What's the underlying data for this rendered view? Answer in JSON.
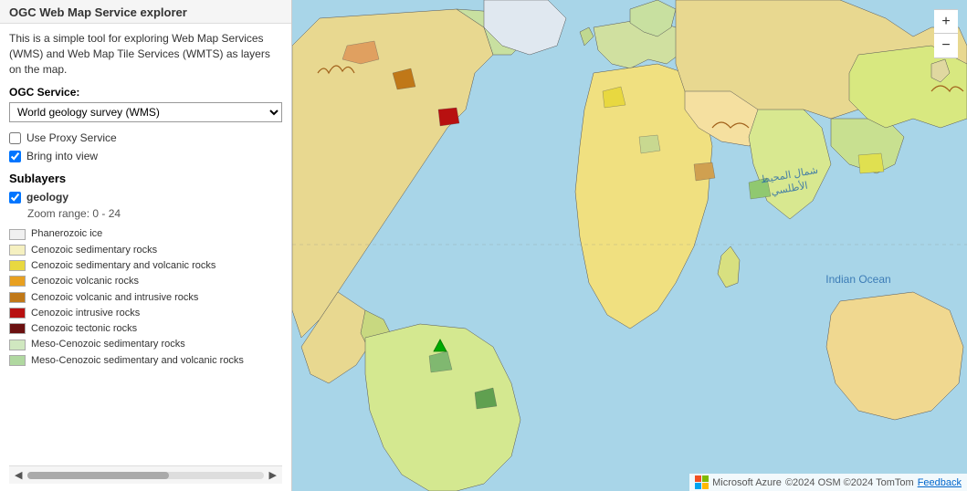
{
  "sidebar": {
    "title": "OGC Web Map Service explorer",
    "description": "This is a simple tool for exploring Web Map Services (WMS) and Web Map Tile Services (WMTS) as layers on the map.",
    "ogc_label": "OGC Service:",
    "service_selected": "World geology survey (WMS)",
    "service_options": [
      "World geology survey (WMS)"
    ],
    "use_proxy_label": "Use Proxy Service",
    "use_proxy_checked": false,
    "bring_into_view_label": "Bring into view",
    "bring_into_view_checked": true,
    "sublayers_title": "Sublayers",
    "sublayer_name": "geology",
    "sublayer_checked": true,
    "zoom_range": "Zoom range: 0 - 24",
    "legend": [
      {
        "color": "#f0f0f0",
        "label": "Phanerozoic ice"
      },
      {
        "color": "#f5f0c0",
        "label": "Cenozoic sedimentary rocks"
      },
      {
        "color": "#e8d840",
        "label": "Cenozoic sedimentary and volcanic rocks"
      },
      {
        "color": "#e8a020",
        "label": "Cenozoic volcanic rocks"
      },
      {
        "color": "#c07818",
        "label": "Cenozoic volcanic and intrusive rocks"
      },
      {
        "color": "#b81010",
        "label": "Cenozoic intrusive rocks"
      },
      {
        "color": "#6b1010",
        "label": "Cenozoic tectonic rocks"
      },
      {
        "color": "#d0e8c0",
        "label": "Meso-Cenozoic sedimentary rocks"
      },
      {
        "color": "#b0d8a0",
        "label": "Meso-Cenozoic sedimentary and volcanic rocks"
      }
    ]
  },
  "map": {
    "ocean_label_atlantic": "شمال المحيط الأطلسي",
    "ocean_label_indian": "Indian Ocean",
    "footer_copyright": "©2024 OSM ©2024 TomTom",
    "feedback_label": "Feedback",
    "microsoft_label": "Microsoft Azure",
    "zoom_in_label": "+",
    "zoom_out_label": "−"
  },
  "colors": {
    "water": "#a8d5e8",
    "land_pale": "#f5f0d0",
    "sidebar_bg": "#ffffff"
  }
}
